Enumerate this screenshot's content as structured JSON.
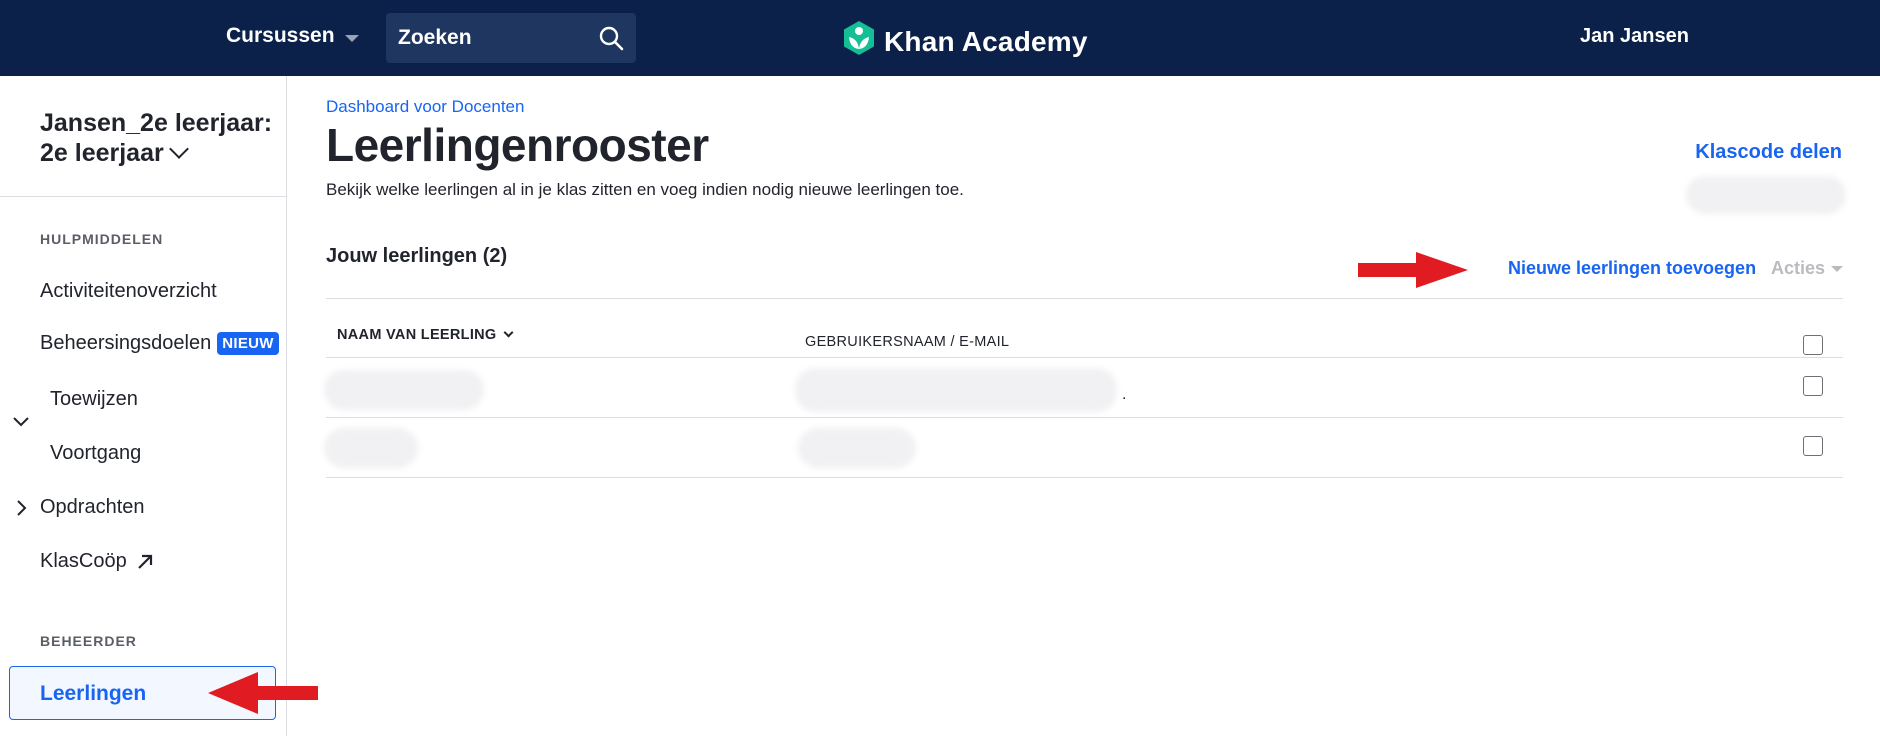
{
  "topbar": {
    "courses_label": "Cursussen",
    "search_placeholder": "Zoeken",
    "logo_text": "Khan Academy",
    "user_name": "Jan Jansen",
    "bg_color": "#0b2149",
    "logo_color": "#14bf96"
  },
  "sidebar": {
    "class_title": "Jansen_2e leerjaar: 2e leerjaar",
    "section_resources": "HULPMIDDELEN",
    "items": {
      "activity": "Activiteitenoverzicht",
      "mastery": "Beheersingsdoelen",
      "mastery_badge": "NIEUW",
      "assign": "Toewijzen",
      "progress": "Voortgang",
      "assignments": "Opdrachten",
      "classcoop": "KlasCoöp"
    },
    "section_admin": "BEHEERDER",
    "active_item": "Leerlingen"
  },
  "main": {
    "breadcrumb": "Dashboard voor Docenten",
    "title": "Leerlingenrooster",
    "subtitle": "Bekijk welke leerlingen al in je klas zitten en voeg indien nodig nieuwe leerlingen toe.",
    "share_code": "Klascode delen",
    "students_heading": "Jouw leerlingen (2)",
    "add_students": "Nieuwe leerlingen toevoegen",
    "actions": "Acties",
    "columns": {
      "name": "NAAM VAN LEERLING",
      "username": "GEBRUIKERSNAAM / E-MAIL"
    },
    "rows": [
      {
        "name": "",
        "username": ""
      },
      {
        "name": "",
        "username": ""
      }
    ],
    "accent_color": "#1865f2"
  }
}
